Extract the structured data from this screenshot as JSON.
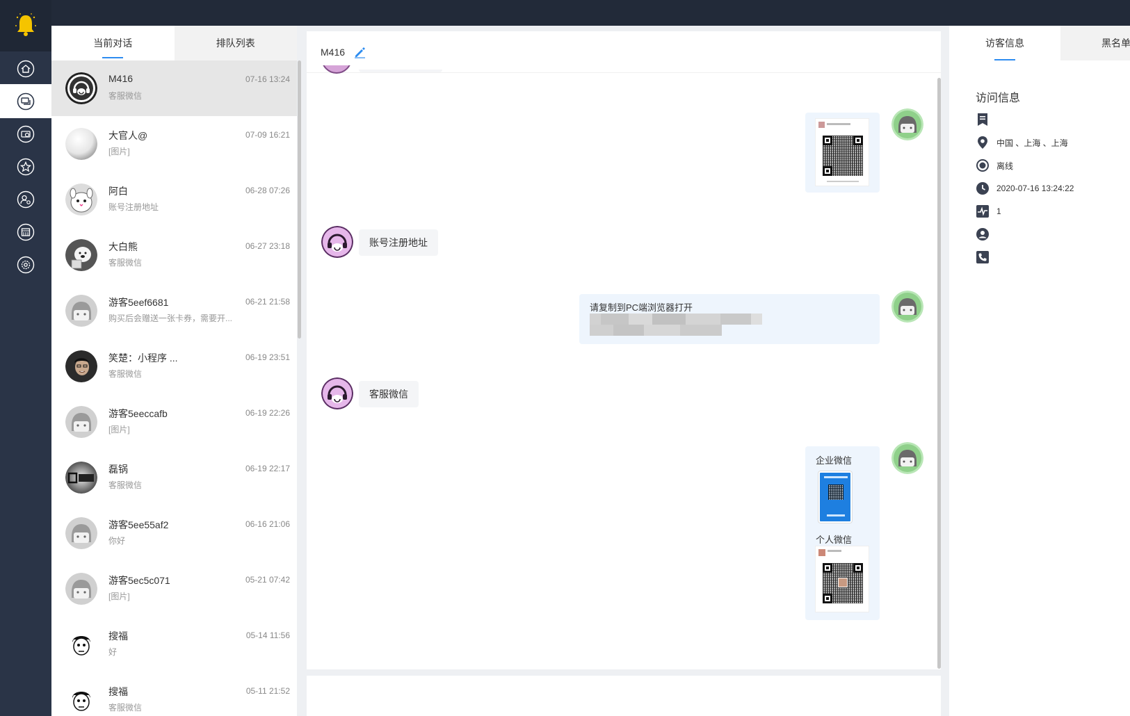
{
  "sidebar": {
    "items": [
      {
        "name": "home"
      },
      {
        "name": "chat"
      },
      {
        "name": "history"
      },
      {
        "name": "favorites"
      },
      {
        "name": "visitors"
      },
      {
        "name": "calendar"
      },
      {
        "name": "settings"
      }
    ]
  },
  "conversations": {
    "tabs": [
      "当前对话",
      "排队列表"
    ],
    "items": [
      {
        "name": "M416",
        "time": "07-16 13:24",
        "preview": "客服微信"
      },
      {
        "name": "大官人@",
        "time": "07-09 16:21",
        "preview": "[图片]"
      },
      {
        "name": "阿白",
        "time": "06-28 07:26",
        "preview": "账号注册地址"
      },
      {
        "name": "大白熊",
        "time": "06-27 23:18",
        "preview": "客服微信"
      },
      {
        "name": "游客5eef6681",
        "time": "06-21 21:58",
        "preview": "购买后会赠送一张卡券，需要开..."
      },
      {
        "name": "笑楚：小程序 ...",
        "time": "06-19 23:51",
        "preview": "客服微信"
      },
      {
        "name": "游客5eeccafb",
        "time": "06-19 22:26",
        "preview": "[图片]"
      },
      {
        "name": "磊锅",
        "time": "06-19 22:17",
        "preview": "客服微信"
      },
      {
        "name": "游客5ee55af2",
        "time": "06-16 21:06",
        "preview": "你好"
      },
      {
        "name": "游客5ec5c071",
        "time": "05-21 07:42",
        "preview": "[图片]"
      },
      {
        "name": "搜福",
        "time": "05-14 11:56",
        "preview": "好"
      },
      {
        "name": "搜福",
        "time": "05-11 21:52",
        "preview": "客服微信"
      }
    ]
  },
  "chat": {
    "title": "M416",
    "messages": {
      "in1": "账号注册地址",
      "out2_line1": "请复制到PC端浏览器打开",
      "in2": "客服微信",
      "out3_label1": "企业微信",
      "out3_label2": "个人微信"
    }
  },
  "visitor": {
    "tabs": [
      "访客信息",
      "黑名单"
    ],
    "section_title": "访问信息",
    "location": "中国 、上海 、上海",
    "status": "离线",
    "time": "2020-07-16 13:24:22",
    "visits": "1"
  }
}
